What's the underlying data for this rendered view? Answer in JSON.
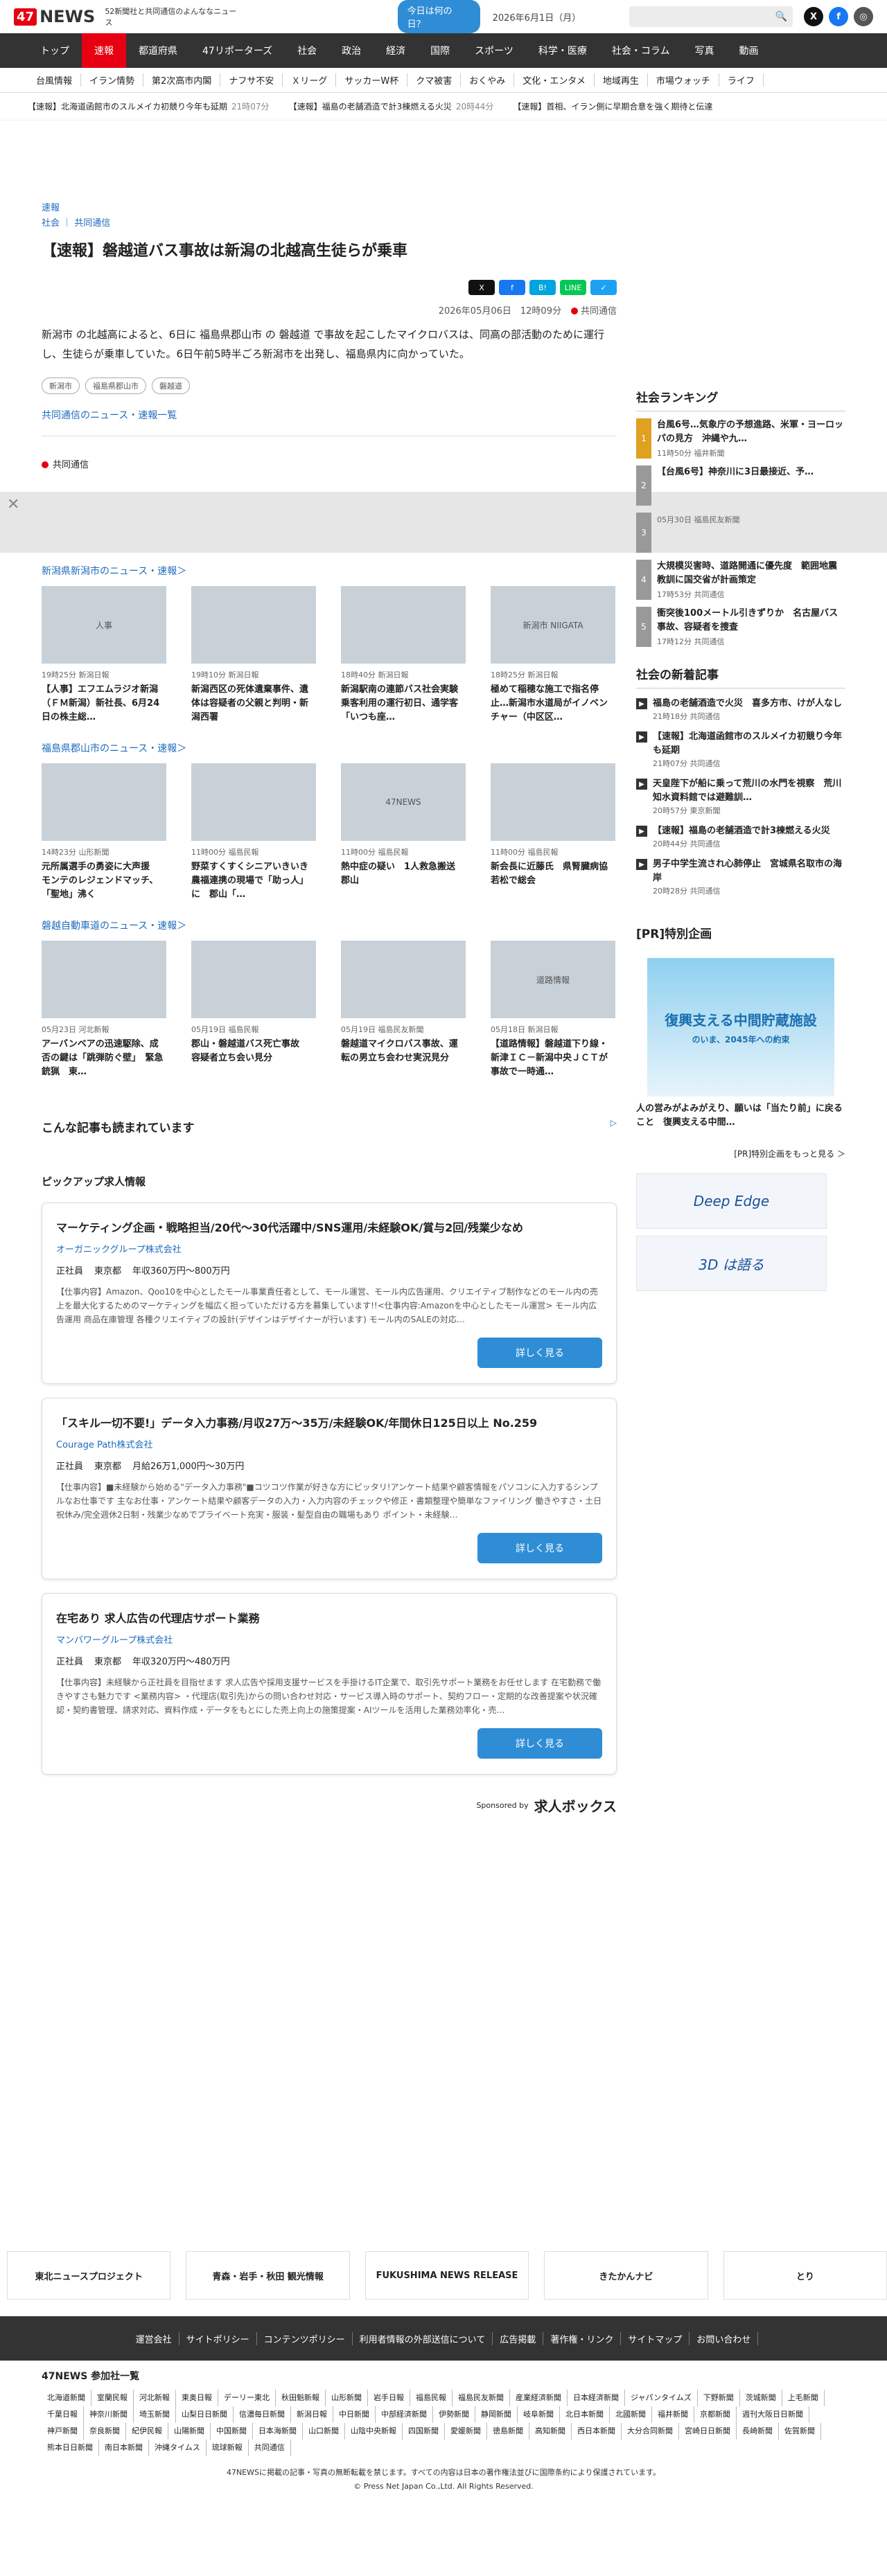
{
  "header": {
    "logo": "47NEWS",
    "tagline": "52新聞社と共同通信のよんななニュース",
    "today_btn": "今日は何の日？",
    "date": "2026年6月1日（月）"
  },
  "gnav": [
    "トップ",
    "速報",
    "都道府県",
    "47リポーターズ",
    "社会",
    "政治",
    "経済",
    "国際",
    "スポーツ",
    "科学・医療",
    "社会・コラム",
    "写真",
    "動画"
  ],
  "subnav": [
    "台風情報",
    "イラン情勢",
    "第2次高市内閣",
    "ナフサ不安",
    "Ｘリーグ",
    "サッカーW杯",
    "クマ被害",
    "おくやみ",
    "文化・エンタメ",
    "地域再生",
    "市場ウォッチ",
    "ライフ"
  ],
  "ticker": [
    {
      "text": "【速報】北海道函館市のスルメイカ初競り今年も延期",
      "time": "21時07分"
    },
    {
      "text": "【速報】福島の老舗酒造で計3棟燃える火災",
      "time": "20時44分"
    },
    {
      "text": "【速報】首相、イラン側に早期合意を強く期待と伝達",
      "time": ""
    }
  ],
  "article": {
    "crumb1": "速報",
    "crumb2": "社会 ｜ 共同通信",
    "title": "【速報】磐越道バス事故は新潟の北越高生徒らが乗車",
    "share": [
      "X",
      "f",
      "B!",
      "LINE",
      "✓"
    ],
    "datetime": "2026年05月06日　12時09分",
    "source": "共同通信",
    "body": "新潟市 の北越高によると、6日に 福島県郡山市 の 磐越道 で事故を起こしたマイクロバスは、同高の部活動のために運行し、生徒らが乗車していた。6日午前5時半ごろ新潟市を出発し、福島県内に向かっていた。",
    "tags": [
      "新潟市",
      "福島県郡山市",
      "磐越道"
    ],
    "more": "共同通信のニュース・速報一覧",
    "footer_source": "共同通信"
  },
  "sections": [
    {
      "title": "新潟県新潟市のニュース・速報＞",
      "cards": [
        {
          "img": "人事",
          "time": "19時25分",
          "src": "新潟日報",
          "title": "【人事】エフエムラジオ新潟（ＦＭ新潟）新社長、6月24日の株主総…"
        },
        {
          "img": "",
          "time": "19時10分",
          "src": "新潟日報",
          "title": "新潟西区の死体遺棄事件、遺体は容疑者の父親と判明・新潟西署"
        },
        {
          "img": "",
          "time": "18時40分",
          "src": "新潟日報",
          "title": "新潟駅南の連節バス社会実験　乗客利用の運行初日、通学客「いつも座…"
        },
        {
          "img": "新潟市 NIIGATA",
          "time": "18時25分",
          "src": "新潟日報",
          "title": "極めて稲穂な施工で指名停止…新潟市水道局がイノベンチャー（中区区…"
        }
      ]
    },
    {
      "title": "福島県郡山市のニュース・速報＞",
      "cards": [
        {
          "img": "",
          "time": "14時23分",
          "src": "山形新聞",
          "title": "元所属選手の勇姿に大声援　モンテのレジェンドマッチ、「聖地」沸く"
        },
        {
          "img": "",
          "time": "11時00分",
          "src": "福島民報",
          "title": "野菜すくすくシニアいきいき　農福連携の現場で「助っ人」に　郡山「…"
        },
        {
          "img": "47NEWS",
          "time": "11時00分",
          "src": "福島民報",
          "title": "熱中症の疑い　1人救急搬送　郡山"
        },
        {
          "img": "",
          "time": "11時00分",
          "src": "福島民報",
          "title": "新会長に近藤氏　県腎臓病協　若松で総会"
        }
      ]
    },
    {
      "title": "磐越自動車道のニュース・速報＞",
      "cards": [
        {
          "img": "",
          "time": "05月23日",
          "src": "河北新報",
          "title": "アーバンベアの迅速駆除、成否の鍵は「跳弾防ぐ壁」　緊急銃猟　東…"
        },
        {
          "img": "",
          "time": "05月19日",
          "src": "福島民報",
          "title": "郡山・磐越道バス死亡事故　容疑者立ち会い見分"
        },
        {
          "img": "",
          "time": "05月19日",
          "src": "福島民友新聞",
          "title": "磐越道マイクロバス事故、運転の男立ち会わせ実況見分"
        },
        {
          "img": "道路情報",
          "time": "05月18日",
          "src": "新潟日報",
          "title": "【道路情報】磐越道下り線・新津ＩＣ－新潟中央ＪＣＴが事故で一時通…"
        }
      ]
    }
  ],
  "read_also": "こんな記事も読まれています",
  "jobs_title": "ピックアップ求人情報",
  "jobs": [
    {
      "title": "マーケティング企画・戦略担当/20代〜30代活躍中/SNS運用/未経験OK/賞与2回/残業少なめ",
      "company": "オーガニックグループ株式会社",
      "type": "正社員",
      "place": "東京都",
      "salary": "年収360万円〜800万円",
      "desc": "【仕事内容】Amazon、Qoo10を中心としたモール事業責任者として、モール運営、モール内広告運用、クリエイティブ制作などのモール内の売上を最大化するためのマーケティングを幅広く担っていただける方を募集しています!!<仕事内容:Amazonを中心としたモール運営> モール内広告運用 商品在庫管理 各種クリエイティブの設計(デザインはデザイナーが行います) モール内のSALEの対応…",
      "btn": "詳しく見る"
    },
    {
      "title": "「スキル一切不要!」データ入力事務/月収27万〜35万/未経験OK/年間休日125日以上 No.259",
      "company": "Courage Path株式会社",
      "type": "正社員",
      "place": "東京都",
      "salary": "月給26万1,000円〜30万円",
      "desc": "【仕事内容】■未経験から始める\"データ入力事務\"■コツコツ作業が好きな方にピッタリ!アンケート結果や顧客情報をパソコンに入力するシンプルなお仕事です 主なお仕事・アンケート結果や顧客データの入力・入力内容のチェックや修正・書類整理や簡単なファイリング 働きやすさ・土日祝休み/完全週休2日制・残業少なめでプライベート充実・服装・髪型自由の職場もあり ポイント・未経験…",
      "btn": "詳しく見る"
    },
    {
      "title": "在宅あり 求人広告の代理店サポート業務",
      "company": "マンパワーグループ株式会社",
      "type": "正社員",
      "place": "東京都",
      "salary": "年収320万円〜480万円",
      "desc": "【仕事内容】未経験から正社員を目指せます 求人広告や採用支援サービスを手掛けるIT企業で、取引先サポート業務をお任せします 在宅勤務で働きやすさも魅力です <業務内容> ・代理店(取引先)からの問い合わせ対応・サービス導入時のサポート、契約フロー・定期的な改善提案や状況確認・契約書管理、請求対応、資料作成・データをもとにした売上向上の施策提案・AIツールを活用した業務効率化・売…",
      "btn": "詳しく見る"
    }
  ],
  "sponsor": {
    "label": "Sponsored by",
    "name": "求人ボックス"
  },
  "sidebar": {
    "ranking_title": "社会ランキング",
    "ranking": [
      {
        "n": "1",
        "title": "台風6号…気象庁の予想進路、米軍・ヨーロッパの見方　沖縄や九…",
        "time": "11時50分",
        "src": "福井新聞"
      },
      {
        "n": "2",
        "title": "【台風6号】神奈川に3日最接近、予…",
        "time": "",
        "src": ""
      },
      {
        "n": "3",
        "title": "",
        "time": "05月30日",
        "src": "福島民友新聞"
      },
      {
        "n": "4",
        "title": "大規模災害時、道路開通に優先度　範囲地震教訓に国交省が計画策定",
        "time": "17時53分",
        "src": "共同通信"
      },
      {
        "n": "5",
        "title": "衝突後100メートル引きずりか　名古屋バス事故、容疑者を捜査",
        "time": "17時12分",
        "src": "共同通信"
      }
    ],
    "latest_title": "社会の新着記事",
    "latest": [
      {
        "title": "福島の老舗酒造で火災　喜多方市、けが人なし",
        "time": "21時18分",
        "src": "共同通信"
      },
      {
        "title": "【速報】北海道函館市のスルメイカ初競り今年も延期",
        "time": "21時07分",
        "src": "共同通信"
      },
      {
        "title": "天皇陛下が船に乗って荒川の水門を視察　荒川知水資料館では避難訓…",
        "time": "20時57分",
        "src": "東京新聞"
      },
      {
        "title": "【速報】福島の老舗酒造で計3棟燃える火災",
        "time": "20時44分",
        "src": "共同通信"
      },
      {
        "title": "男子中学生流され心肺停止　宮城県名取市の海岸",
        "time": "20時28分",
        "src": "共同通信"
      }
    ],
    "pr_title": "[PR]特別企画",
    "pr_img_title": "復興支える中間貯蔵施設",
    "pr_img_sub": "のいま、2045年への約束",
    "pr_caption": "人の営みがよみがえり、願いは「当たり前」に戻ること　復興支える中間…",
    "pr_more": "[PR]特別企画をもっと見る ＞",
    "banner1": "Deep Edge",
    "banner2": "3D は語る"
  },
  "ad_strip": [
    "東北ニュースプロジェクト",
    "青森・岩手・秋田 観光情報",
    "FUKUSHIMA NEWS RELEASE",
    "きたかんナビ",
    "とり"
  ],
  "footnav": [
    "運営会社",
    "サイトポリシー",
    "コンテンツポリシー",
    "利用者情報の外部送信について",
    "広告掲載",
    "著作権・リンク",
    "サイトマップ",
    "お問い合わせ"
  ],
  "members_title": "47NEWS 参加社一覧",
  "members": [
    "北海道新聞",
    "室蘭民報",
    "河北新報",
    "東奥日報",
    "デーリー東北",
    "秋田魁新報",
    "山形新聞",
    "岩手日報",
    "福島民報",
    "福島民友新聞",
    "産業経済新聞",
    "日本経済新聞",
    "ジャパンタイムズ",
    "下野新聞",
    "茨城新聞",
    "上毛新聞",
    "千葉日報",
    "神奈川新聞",
    "埼玉新聞",
    "山梨日日新聞",
    "信濃毎日新聞",
    "新潟日報",
    "中日新聞",
    "中部経済新聞",
    "伊勢新聞",
    "静岡新聞",
    "岐阜新聞",
    "北日本新聞",
    "北國新聞",
    "福井新聞",
    "京都新聞",
    "週刊大阪日日新聞",
    "神戸新聞",
    "奈良新聞",
    "紀伊民報",
    "山陽新聞",
    "中国新聞",
    "日本海新聞",
    "山口新聞",
    "山陰中央新報",
    "四国新聞",
    "愛媛新聞",
    "徳島新聞",
    "高知新聞",
    "西日本新聞",
    "大分合同新聞",
    "宮崎日日新聞",
    "長崎新聞",
    "佐賀新聞",
    "熊本日日新聞",
    "南日本新聞",
    "沖縄タイムス",
    "琉球新報",
    "共同通信"
  ],
  "copyright1": "47NEWSに掲載の記事・写真の無断転載を禁じます。すべての内容は日本の著作権法並びに国際条約により保護されています。",
  "copyright2": "© Press Net Japan Co.,Ltd. All Rights Reserved."
}
